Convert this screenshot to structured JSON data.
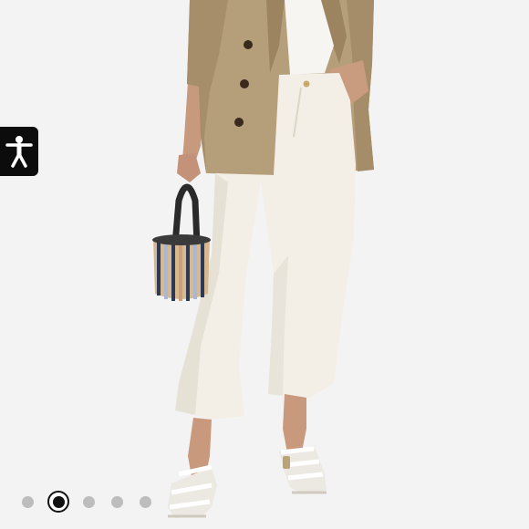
{
  "accessibility": {
    "icon": "accessibility-icon",
    "color": "#0c0c0c"
  },
  "gallery": {
    "image_count": 5,
    "active_index": 2,
    "dot_color": "#bdbdbd",
    "active_color": "#111111"
  }
}
